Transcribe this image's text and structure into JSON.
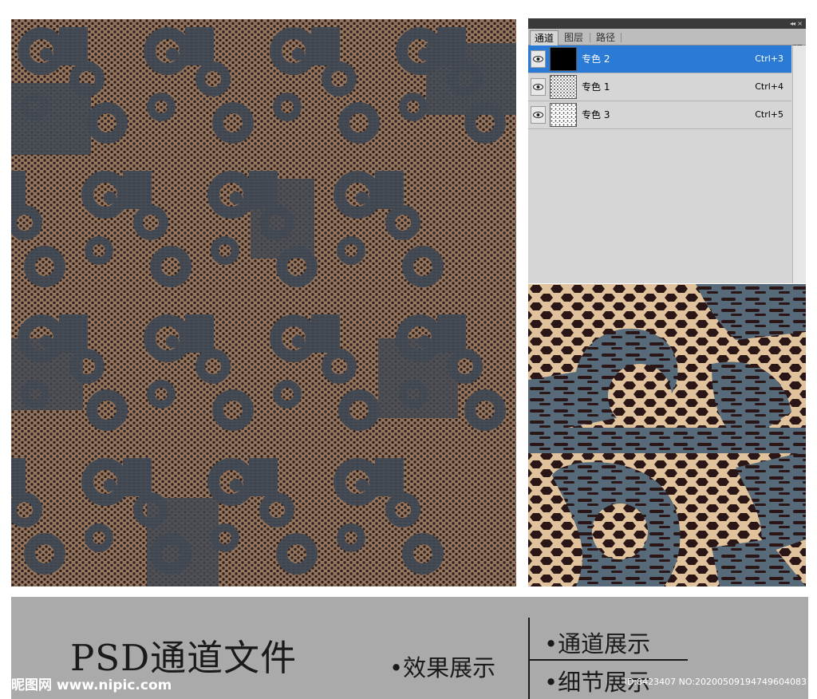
{
  "panel": {
    "tabs": [
      {
        "label": "通道",
        "active": true
      },
      {
        "label": "图层",
        "active": false
      },
      {
        "label": "路径",
        "active": false
      }
    ],
    "collapse_glyph": "◂◂",
    "close_glyph": "×",
    "menu_glyph": "▾≡",
    "channels": [
      {
        "name": "专色 2",
        "shortcut": "Ctrl+3",
        "selected": true,
        "thumb": "solid-black"
      },
      {
        "name": "专色 1",
        "shortcut": "Ctrl+4",
        "selected": false,
        "thumb": "speckle"
      },
      {
        "name": "专色 3",
        "shortcut": "Ctrl+5",
        "selected": false,
        "thumb": "speckle"
      }
    ]
  },
  "banner": {
    "title": "PSD通道文件",
    "items": [
      "•效果展示",
      "•通道展示",
      "•细节展示"
    ]
  },
  "watermark": {
    "left": "昵图网 www.nipic.com",
    "right": "ID:8423407 NO:20200509194749604083"
  },
  "colors": {
    "pattern_tan": "#96765e",
    "pattern_slate": "#454b55",
    "detail_dark": "#2a1616",
    "detail_tan": "#e0c29c",
    "detail_slate": "#566a7a",
    "selection": "#2a7ad6",
    "banner_bg": "#aaaaaa"
  },
  "icons": {
    "visibility": "eye-icon"
  }
}
